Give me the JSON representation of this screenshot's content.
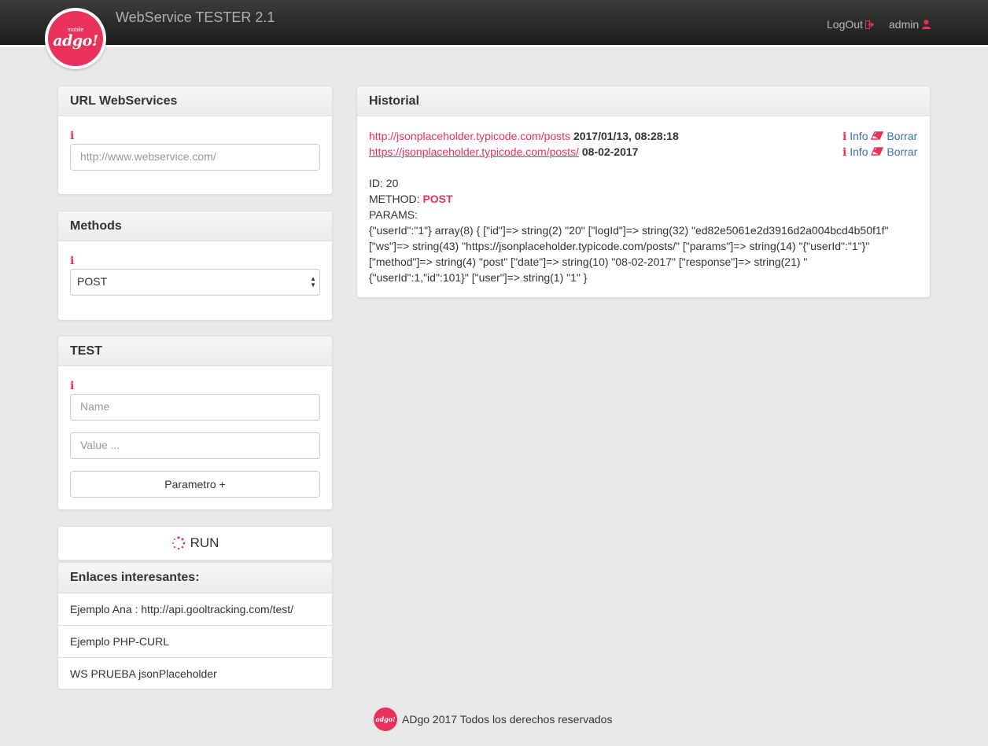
{
  "header": {
    "logo_small": "mobile",
    "logo_text": "adgo!",
    "app_title": "WebService TESTER 2.1",
    "logout_label": "LogOut",
    "user_label": "admin"
  },
  "url_panel": {
    "title": "URL WebServices",
    "info_icon": "i",
    "url_placeholder": "http://www.webservice.com/"
  },
  "methods_panel": {
    "title": "Methods",
    "info_icon": "i",
    "selected_method": "POST"
  },
  "test_panel": {
    "title": "TEST",
    "info_icon": "i",
    "name_placeholder": "Name",
    "value_placeholder": "Value ...",
    "add_param_label": "Parametro +"
  },
  "run_button": {
    "label": "RUN"
  },
  "links_panel": {
    "title": "Enlaces interesantes:",
    "items": [
      "Ejemplo Ana : http://api.gooltracking.com/test/",
      "Ejemplo PHP-CURL",
      "WS PRUEBA jsonPlaceholder"
    ]
  },
  "historial": {
    "title": "Historial",
    "entries": [
      {
        "url": "http://jsonplaceholder.typicode.com/posts",
        "date": "2017/01/13, 08:28:18",
        "info_label": "Info",
        "delete_label": "Borrar"
      },
      {
        "url": "https://jsonplaceholder.typicode.com/posts/",
        "date": "08-02-2017",
        "info_label": "Info",
        "delete_label": "Borrar"
      }
    ],
    "detail": {
      "id_text": "ID: 20",
      "method_label": "METHOD:",
      "method_value": "POST",
      "params_label": "PARAMS:",
      "params_lines": [
        "{\"userId\":\"1\"} array(8) { [\"id\"]=> string(2) \"20\" [\"logId\"]=> string(32) \"ed82e5061e2d3916d2a004bcd4b50f1f\"",
        "[\"ws\"]=> string(43) \"https://jsonplaceholder.typicode.com/posts/\" [\"params\"]=> string(14) \"{\"userId\":\"1\"}\"",
        "[\"method\"]=> string(4) \"post\" [\"date\"]=> string(10) \"08-02-2017\" [\"response\"]=> string(21) \"",
        "{\"userId\":1,\"id\":101}\" [\"user\"]=> string(1) \"1\" }"
      ]
    }
  },
  "footer": {
    "logo_text": "adgo!",
    "text": "ADgo 2017 Todos los derechos reservados"
  },
  "colors": {
    "accent": "#e8315b",
    "link": "#3a6fb0",
    "topbar": "#2a2a2a",
    "background": "#e9e9e9"
  }
}
